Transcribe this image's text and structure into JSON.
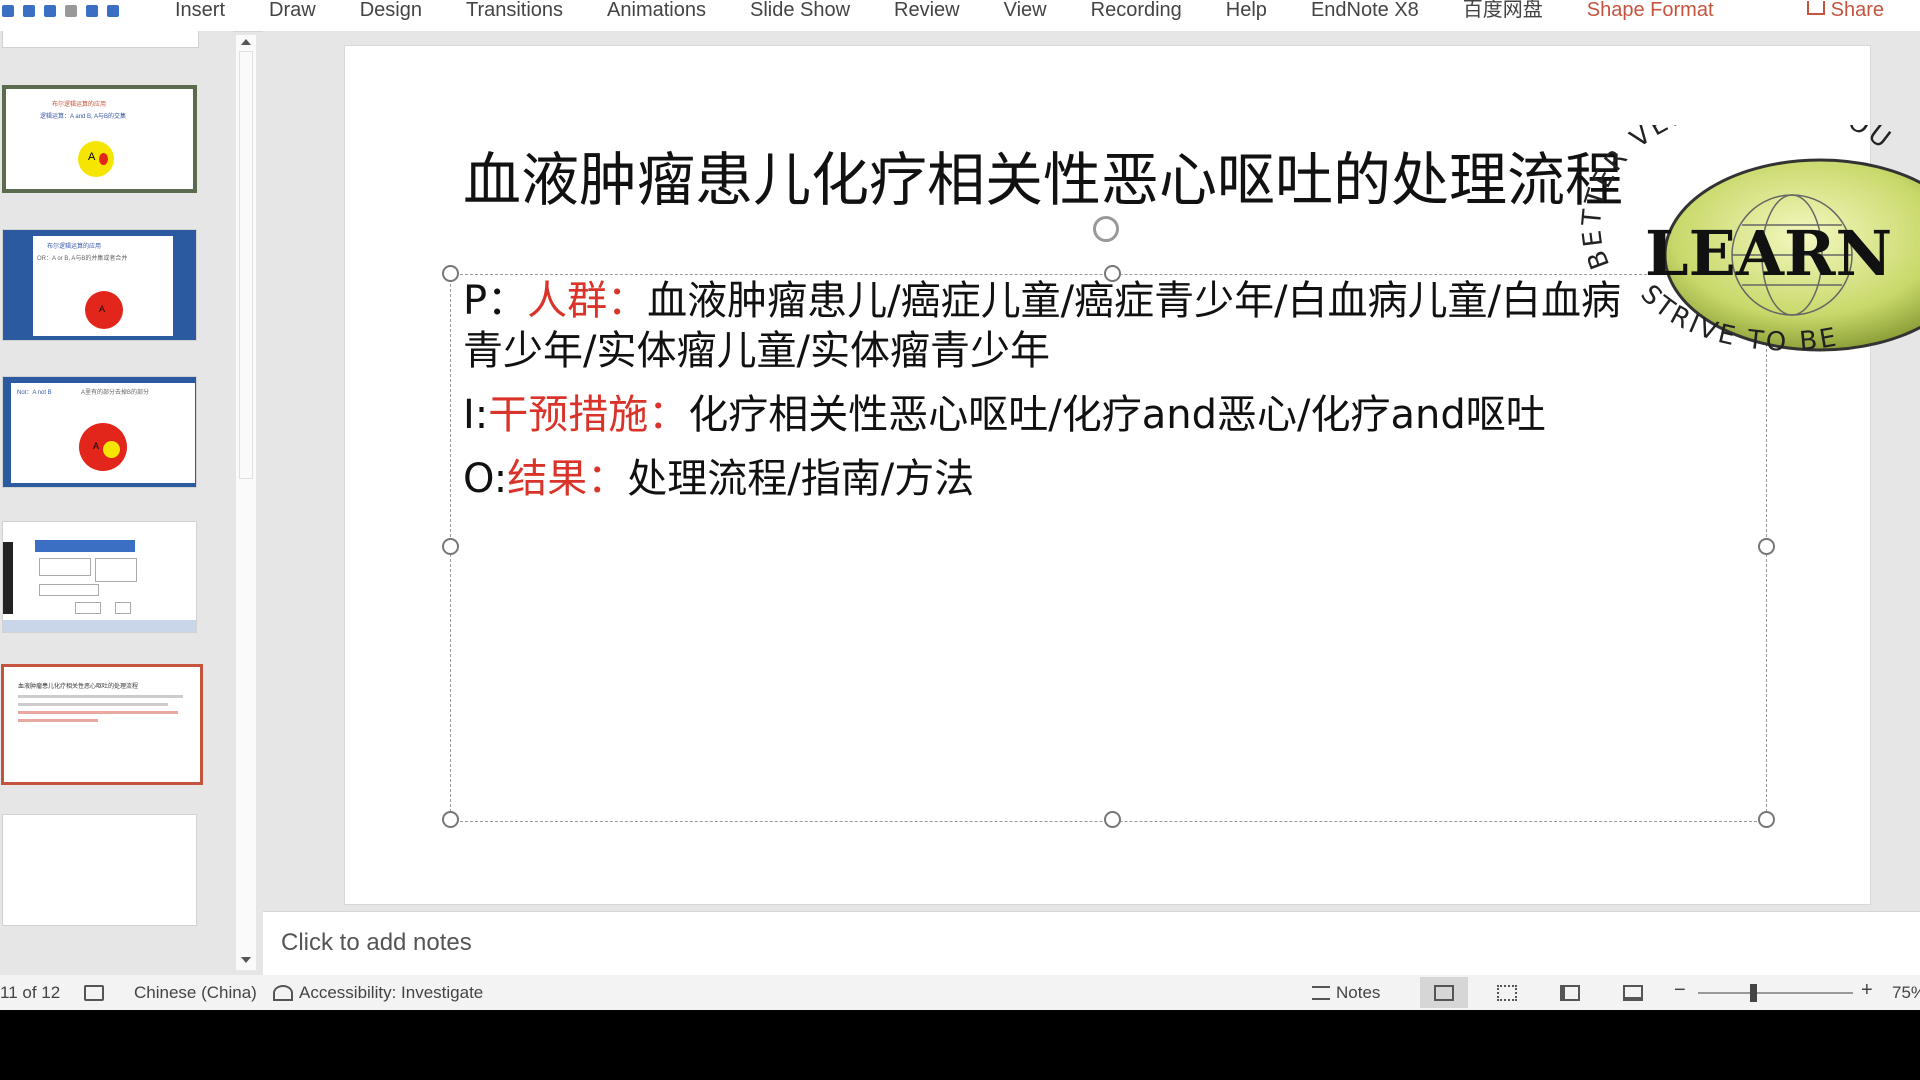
{
  "ribbon": {
    "tabs": [
      "Insert",
      "Draw",
      "Design",
      "Transitions",
      "Animations",
      "Slide Show",
      "Review",
      "View",
      "Recording",
      "Help",
      "EndNote X8",
      "百度网盘",
      "Shape Format"
    ],
    "share_label": "Share"
  },
  "slide": {
    "title": "血液肿瘤患儿化疗相关性恶心呕吐的处理流程",
    "p_prefix": "P：",
    "p_key": "人群：",
    "p_text": "血液肿瘤患儿/癌症儿童/癌症青少年/白血病儿童/白血病青少年/实体瘤儿童/实体瘤青少年",
    "i_prefix": "I:",
    "i_key": "干预措施：",
    "i_text": "化疗相关性恶心呕吐/化疗and恶心/化疗and呕吐",
    "o_prefix": "O:",
    "o_key": "结果：",
    "o_text": "处理流程/指南/方法"
  },
  "watermark": {
    "top_text": "BETTER VERSION OF YOU",
    "bottom_text": "STRIVE TO BE",
    "center_text": "LEARN"
  },
  "thumbnails": [
    {
      "title": "布尔逻辑运算的应用",
      "body": "逻辑运算：A and B, A与B的交集",
      "circle": "A"
    },
    {
      "title": "布尔逻辑运算的应用",
      "body": "OR：A or B, A与B的并集或者合并",
      "circle": "A"
    },
    {
      "title": "Not：A not B",
      "body": "A里有的部分去掉B的部分",
      "circle": "A"
    },
    {
      "title": "",
      "body": "",
      "circle": ""
    },
    {
      "title": "血液肿瘤患儿化疗相关性恶心呕吐的处理流程",
      "body": "",
      "circle": ""
    }
  ],
  "notes_placeholder": "Click to add notes",
  "status": {
    "slide_counter": "11 of 12",
    "language": "Chinese (China)",
    "accessibility": "Accessibility: Investigate",
    "notes_label": "Notes",
    "zoom": "75%"
  },
  "colors": {
    "accent": "#c4543d",
    "keyword_red": "#d9332a"
  }
}
